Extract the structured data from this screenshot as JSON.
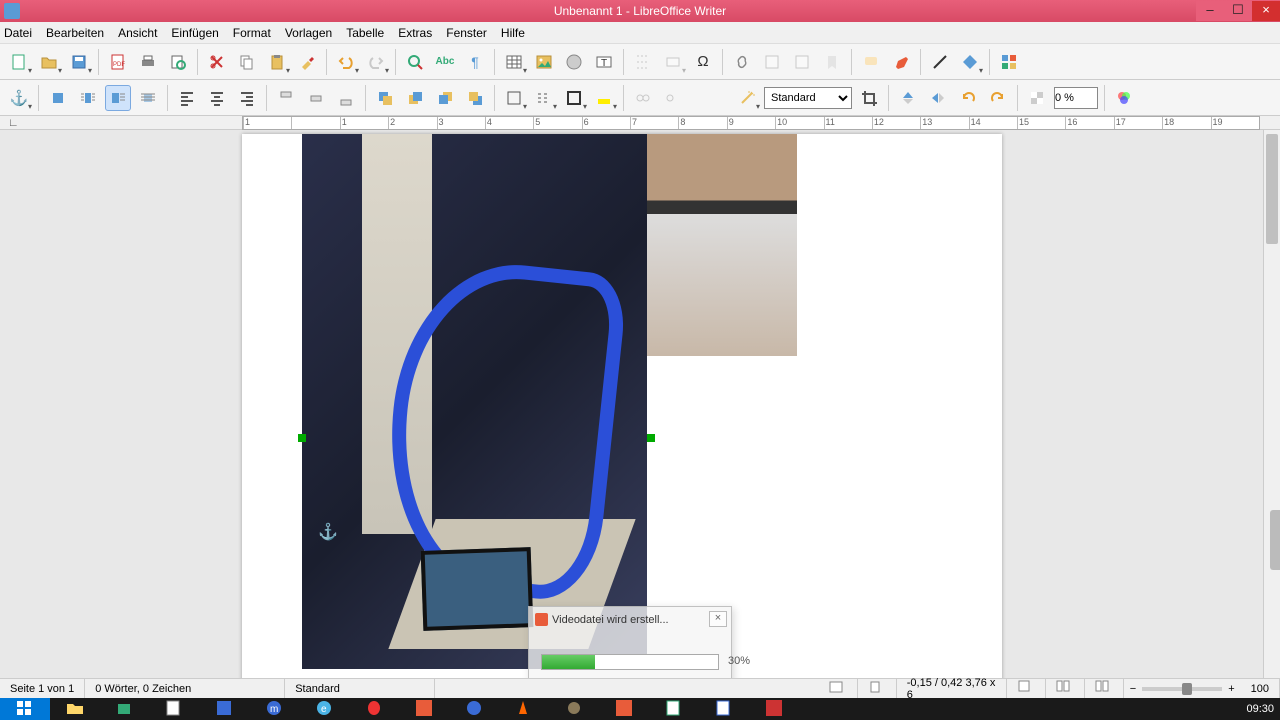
{
  "window": {
    "title": "Unbenannt 1 - LibreOffice Writer",
    "minimize": "–",
    "maxrestore": "☐",
    "close": "×"
  },
  "menu": [
    "Datei",
    "Bearbeiten",
    "Ansicht",
    "Einfügen",
    "Format",
    "Vorlagen",
    "Tabelle",
    "Extras",
    "Fenster",
    "Hilfe"
  ],
  "toolbar2": {
    "style_name": "Standard",
    "transparency": "0 %"
  },
  "dialog": {
    "title": "Videodatei wird erstell...",
    "percent_text": "30%",
    "percent_value": 30
  },
  "ruler": {
    "marks": [
      "1",
      "",
      "1",
      "2",
      "3",
      "4",
      "5",
      "6",
      "7",
      "8",
      "9",
      "10",
      "11",
      "12",
      "13",
      "14",
      "15",
      "16",
      "17",
      "18",
      "19"
    ]
  },
  "status": {
    "page": "Seite 1 von 1",
    "words": "0 Wörter, 0 Zeichen",
    "style": "Standard",
    "coords": "-0,15 / ⁠0,42  3,76 x 6",
    "zoom": "100"
  },
  "taskbar": {
    "clock": "09:30"
  },
  "icons": {
    "anchor": "⚓",
    "abc": "Abc",
    "omega": "Ω",
    "pilcrow": "¶"
  }
}
